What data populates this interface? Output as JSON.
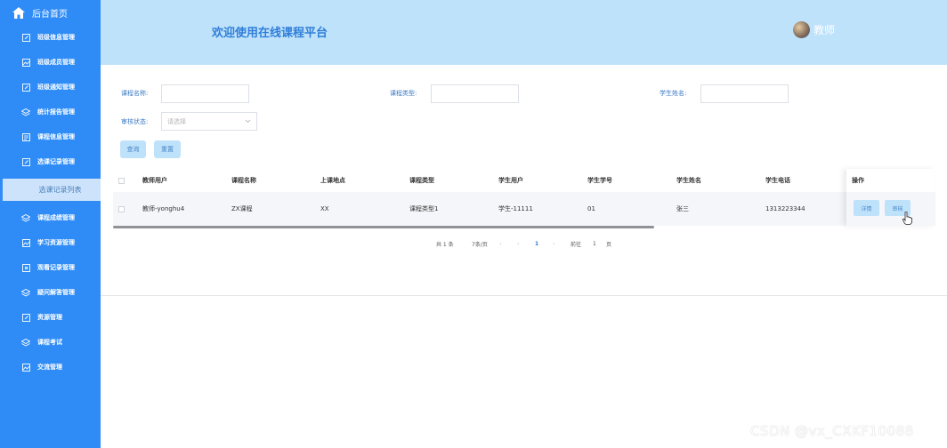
{
  "sidebar": {
    "home": "后台首页",
    "items": [
      {
        "label": "班级信息管理",
        "icon": "edit-icon"
      },
      {
        "label": "班级成员管理",
        "icon": "image-icon"
      },
      {
        "label": "班级通知管理",
        "icon": "edit-icon"
      },
      {
        "label": "统计报告管理",
        "icon": "layers-icon"
      },
      {
        "label": "课程信息管理",
        "icon": "document-icon"
      },
      {
        "label": "选课记录管理",
        "icon": "edit-icon"
      },
      {
        "label": "课程成绩管理",
        "icon": "layers-icon"
      },
      {
        "label": "学习资源管理",
        "icon": "image-icon"
      },
      {
        "label": "观看记录管理",
        "icon": "close-box-icon"
      },
      {
        "label": "疑问解答管理",
        "icon": "layers-icon"
      },
      {
        "label": "资源管理",
        "icon": "edit-icon"
      },
      {
        "label": "课程考试",
        "icon": "layers-icon"
      },
      {
        "label": "交流管理",
        "icon": "image-icon"
      }
    ],
    "active_sub": "选课记录列表"
  },
  "header": {
    "title": "欢迎使用在线课程平台",
    "user": "教师"
  },
  "search": {
    "course_name_label": "课程名称:",
    "course_type_label": "课程类型:",
    "student_name_label": "学生姓名:",
    "audit_status_label": "审核状态:",
    "audit_placeholder": "请选择",
    "query": "查询",
    "reset": "重置"
  },
  "table": {
    "columns": [
      "教师用户",
      "课程名称",
      "上课地点",
      "课程类型",
      "学生用户",
      "学生学号",
      "学生姓名",
      "学生电话",
      "操作"
    ],
    "rows": [
      {
        "teacher": "教师-yonghu4",
        "course": "ZX课程",
        "place": "XX",
        "type": "课程类型1",
        "student_user": "学生-11111",
        "student_no": "01",
        "student_name": "张三",
        "phone": "1313223344"
      }
    ],
    "detail": "详情",
    "audit": "审核"
  },
  "pager": {
    "total": "共 1 条",
    "page_size": "7条/页",
    "page": "1",
    "goto_label": "前往",
    "goto_value": "1",
    "page_unit": "页"
  },
  "watermark": "CSDN @vx_CXKF10088",
  "colors": {
    "sidebar": "#2f8cf6",
    "header": "#bfe2fb",
    "accent": "#2f7ed8",
    "button": "#bfe2fb"
  }
}
